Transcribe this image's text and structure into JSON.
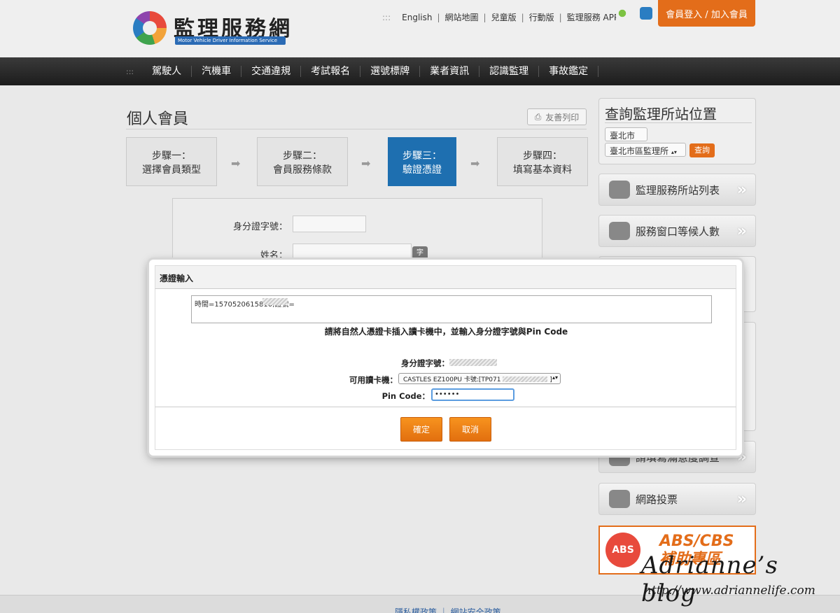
{
  "header": {
    "logo_title": "監理服務網",
    "logo_subtitle": "Motor Vehicle Driver Information Service",
    "top_links": [
      "English",
      "網站地圖",
      "兒童版",
      "行動版",
      "監理服務 APP"
    ],
    "login_label": "會員登入 / 加入會員"
  },
  "nav": {
    "items": [
      "駕駛人",
      "汽機車",
      "交通違規",
      "考試報名",
      "選號標牌",
      "業者資訊",
      "認識監理",
      "事故鑑定"
    ]
  },
  "main": {
    "page_title": "個人會員",
    "print_label": "友善列印",
    "steps": [
      {
        "line1": "步驟一：",
        "line2": "選擇會員類型"
      },
      {
        "line1": "步驟二：",
        "line2": "會員服務條款"
      },
      {
        "line1": "步驟三：",
        "line2": "驗證憑證"
      },
      {
        "line1": "步驟四：",
        "line2": "填寫基本資料"
      }
    ],
    "form": {
      "id_label": "身分證字號：",
      "name_label": "姓名：",
      "keyboard_label": "字"
    }
  },
  "sidebar": {
    "search_title": "查詢監理所站位置",
    "city_value": "臺北市",
    "office_value": "臺北市區監理所",
    "query_label": "查詢",
    "cards": [
      "監理服務所站列表",
      "服務窗口等候人數",
      "請填寫滿意度調查",
      "網路投票"
    ],
    "abs_badge": "ABS",
    "abs_line1": "ABS/CBS",
    "abs_line2": "補助專區"
  },
  "dialog": {
    "title": "憑證輸入",
    "textarea_value": "時間=1570520615810;證號=",
    "message": "請將自然人憑證卡插入讀卡機中，並輸入身分證字號與Pin Code",
    "id_label": "身分證字號：",
    "reader_label": "可用讀卡機：",
    "reader_value": "CASTLES EZ100PU 卡號:[TP071",
    "reader_suffix": "]",
    "pin_label": "Pin Code：",
    "pin_value": "••••••",
    "ok_label": "確定",
    "cancel_label": "取消"
  },
  "footer": {
    "links": "隱私權政策 ｜ 網站安全政策"
  },
  "watermark": {
    "name": "Adrianne’s blog",
    "url": "http://www.adriannelife.com"
  },
  "colors": {
    "accent": "#e36d1a",
    "step_active": "#1e6fb0",
    "nav_bg": "#2a2a2a"
  }
}
